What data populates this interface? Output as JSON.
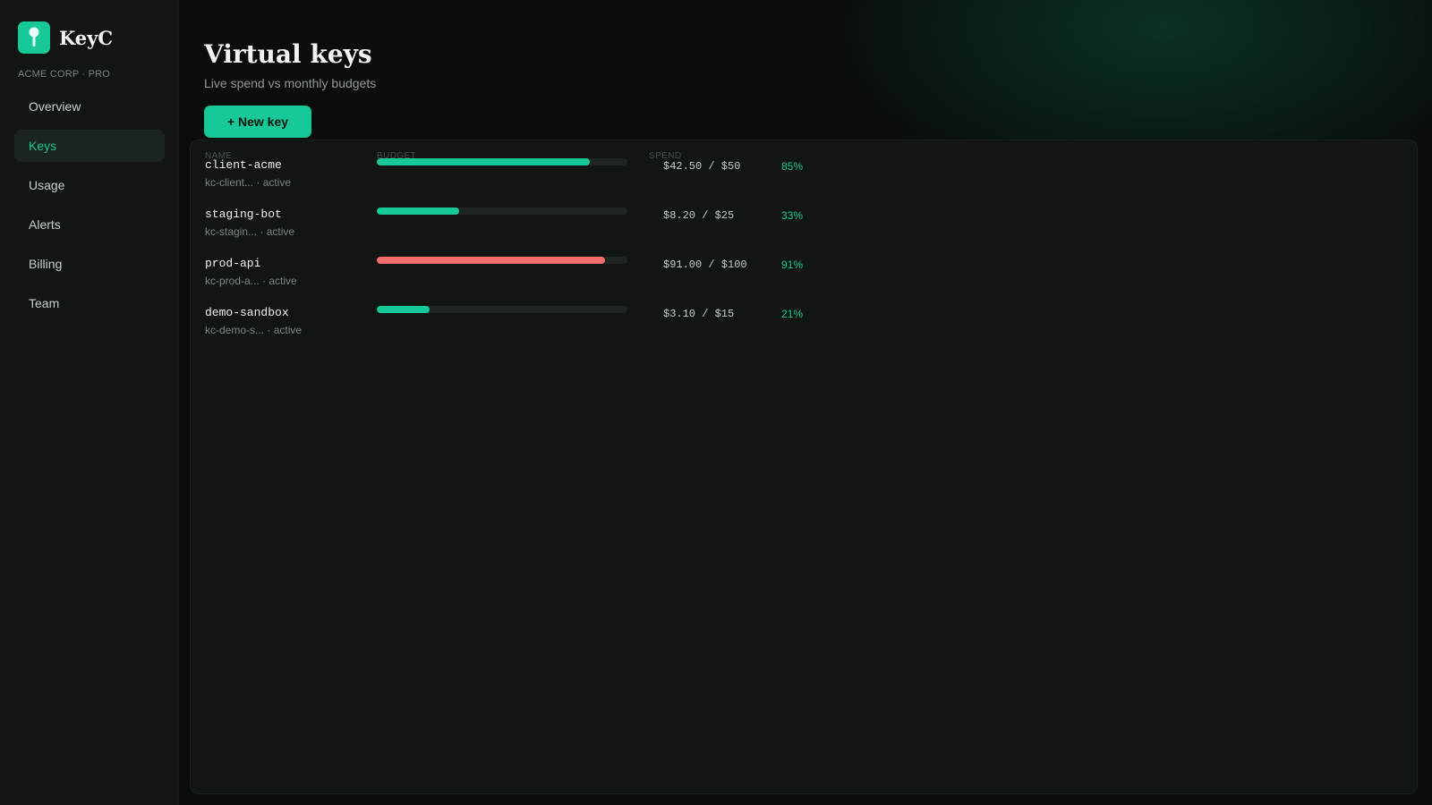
{
  "brand": {
    "name": "KeyC",
    "org": "ACME CORP · PRO",
    "logo_icon": "key-icon"
  },
  "nav": {
    "items": [
      {
        "label": "Overview",
        "active": false
      },
      {
        "label": "Keys",
        "active": true
      },
      {
        "label": "Usage",
        "active": false
      },
      {
        "label": "Alerts",
        "active": false
      },
      {
        "label": "Billing",
        "active": false
      },
      {
        "label": "Team",
        "active": false
      }
    ]
  },
  "page": {
    "title": "Virtual keys",
    "subtitle": "Live spend vs monthly budgets",
    "new_key_label": "+ New key"
  },
  "table": {
    "headers": {
      "name": "NAME",
      "budget": "BUDGET",
      "spend": "SPEND"
    },
    "rows": [
      {
        "name": "client-acme",
        "key_id": "kc-client...",
        "status": "active",
        "spend": "$42.50 / $50",
        "percent": "85%",
        "fraction": 0.85,
        "bar_color": "#17c997"
      },
      {
        "name": "staging-bot",
        "key_id": "kc-stagin...",
        "status": "active",
        "spend": "$8.20 / $25",
        "percent": "33%",
        "fraction": 0.33,
        "bar_color": "#17c997"
      },
      {
        "name": "prod-api",
        "key_id": "kc-prod-a...",
        "status": "active",
        "spend": "$91.00 / $100",
        "percent": "91%",
        "fraction": 0.91,
        "bar_color": "#f26d6d"
      },
      {
        "name": "demo-sandbox",
        "key_id": "kc-demo-s...",
        "status": "active",
        "spend": "$3.10 / $15",
        "percent": "21%",
        "fraction": 0.21,
        "bar_color": "#17c997"
      }
    ]
  },
  "colors": {
    "accent": "#17c997",
    "danger": "#f26d6d",
    "background": "#0a0d0c",
    "sidebar": "#111514",
    "panel": "#111614"
  }
}
